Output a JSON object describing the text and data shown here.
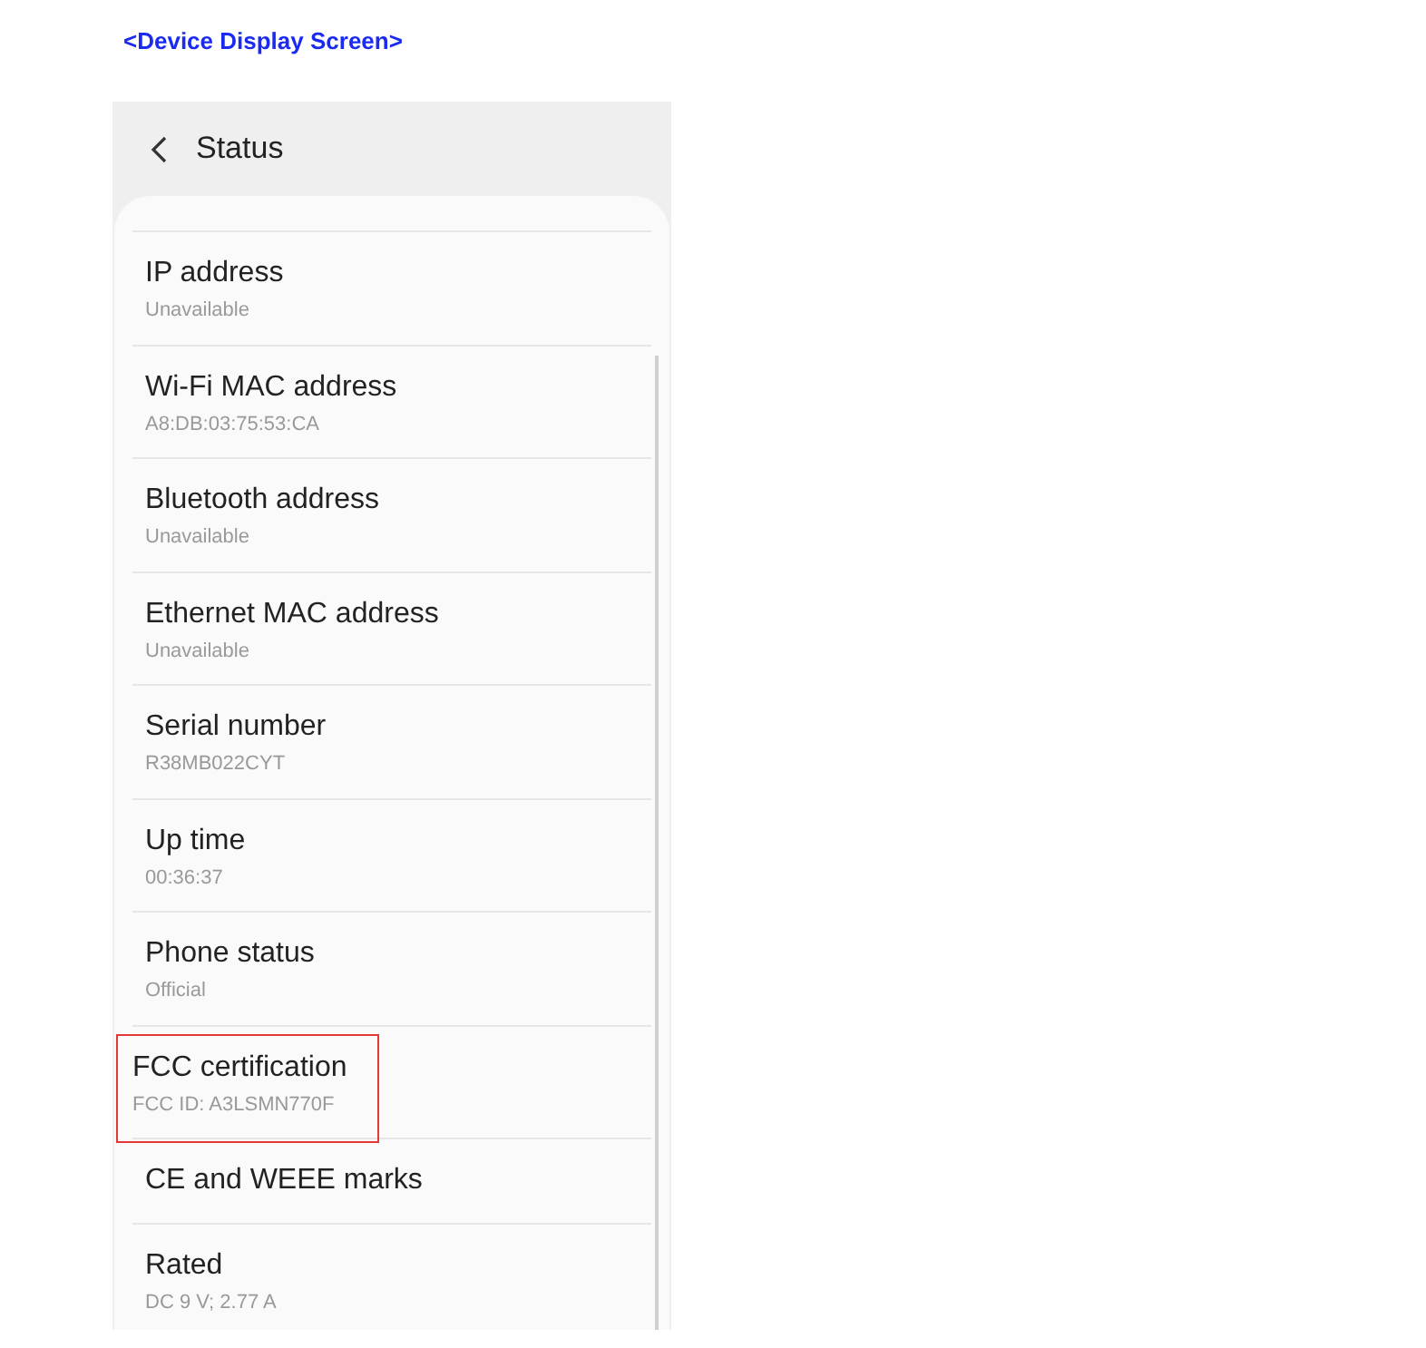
{
  "heading": "<Device Display Screen>",
  "header": {
    "title": "Status"
  },
  "items": [
    {
      "title": "IP address",
      "value": "Unavailable",
      "highlighted": false
    },
    {
      "title": "Wi-Fi MAC address",
      "value": "A8:DB:03:75:53:CA",
      "highlighted": false
    },
    {
      "title": "Bluetooth address",
      "value": "Unavailable",
      "highlighted": false
    },
    {
      "title": "Ethernet MAC address",
      "value": "Unavailable",
      "highlighted": false
    },
    {
      "title": "Serial number",
      "value": "R38MB022CYT",
      "highlighted": false
    },
    {
      "title": "Up time",
      "value": "00:36:37",
      "highlighted": false
    },
    {
      "title": "Phone status",
      "value": "Official",
      "highlighted": false
    },
    {
      "title": "FCC certification",
      "value": "FCC ID: A3LSMN770F",
      "highlighted": true
    },
    {
      "title": "CE and WEEE marks",
      "highlighted": false
    },
    {
      "title": "Rated",
      "value": "DC 9 V; 2.77 A",
      "highlighted": false
    }
  ]
}
